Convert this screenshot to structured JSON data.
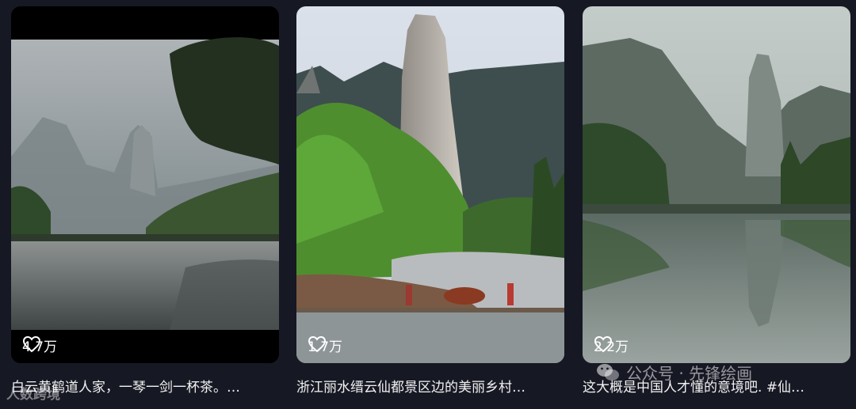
{
  "feed": {
    "cards": [
      {
        "likes": "4.7万",
        "caption": "白云黄鹤道人家，一琴一剑一杯茶。…"
      },
      {
        "likes": "1.7万",
        "caption": "浙江丽水缙云仙都景区边的美丽乡村…"
      },
      {
        "likes": "2.2万",
        "caption": "这大概是中国人才懂的意境吧. #仙…"
      }
    ]
  },
  "watermarks": {
    "left": "人数跨境",
    "right": "公众号 · 先锋绘画"
  },
  "icons": {
    "like": "heart-outline-icon",
    "watermark": "wechat-icon"
  }
}
